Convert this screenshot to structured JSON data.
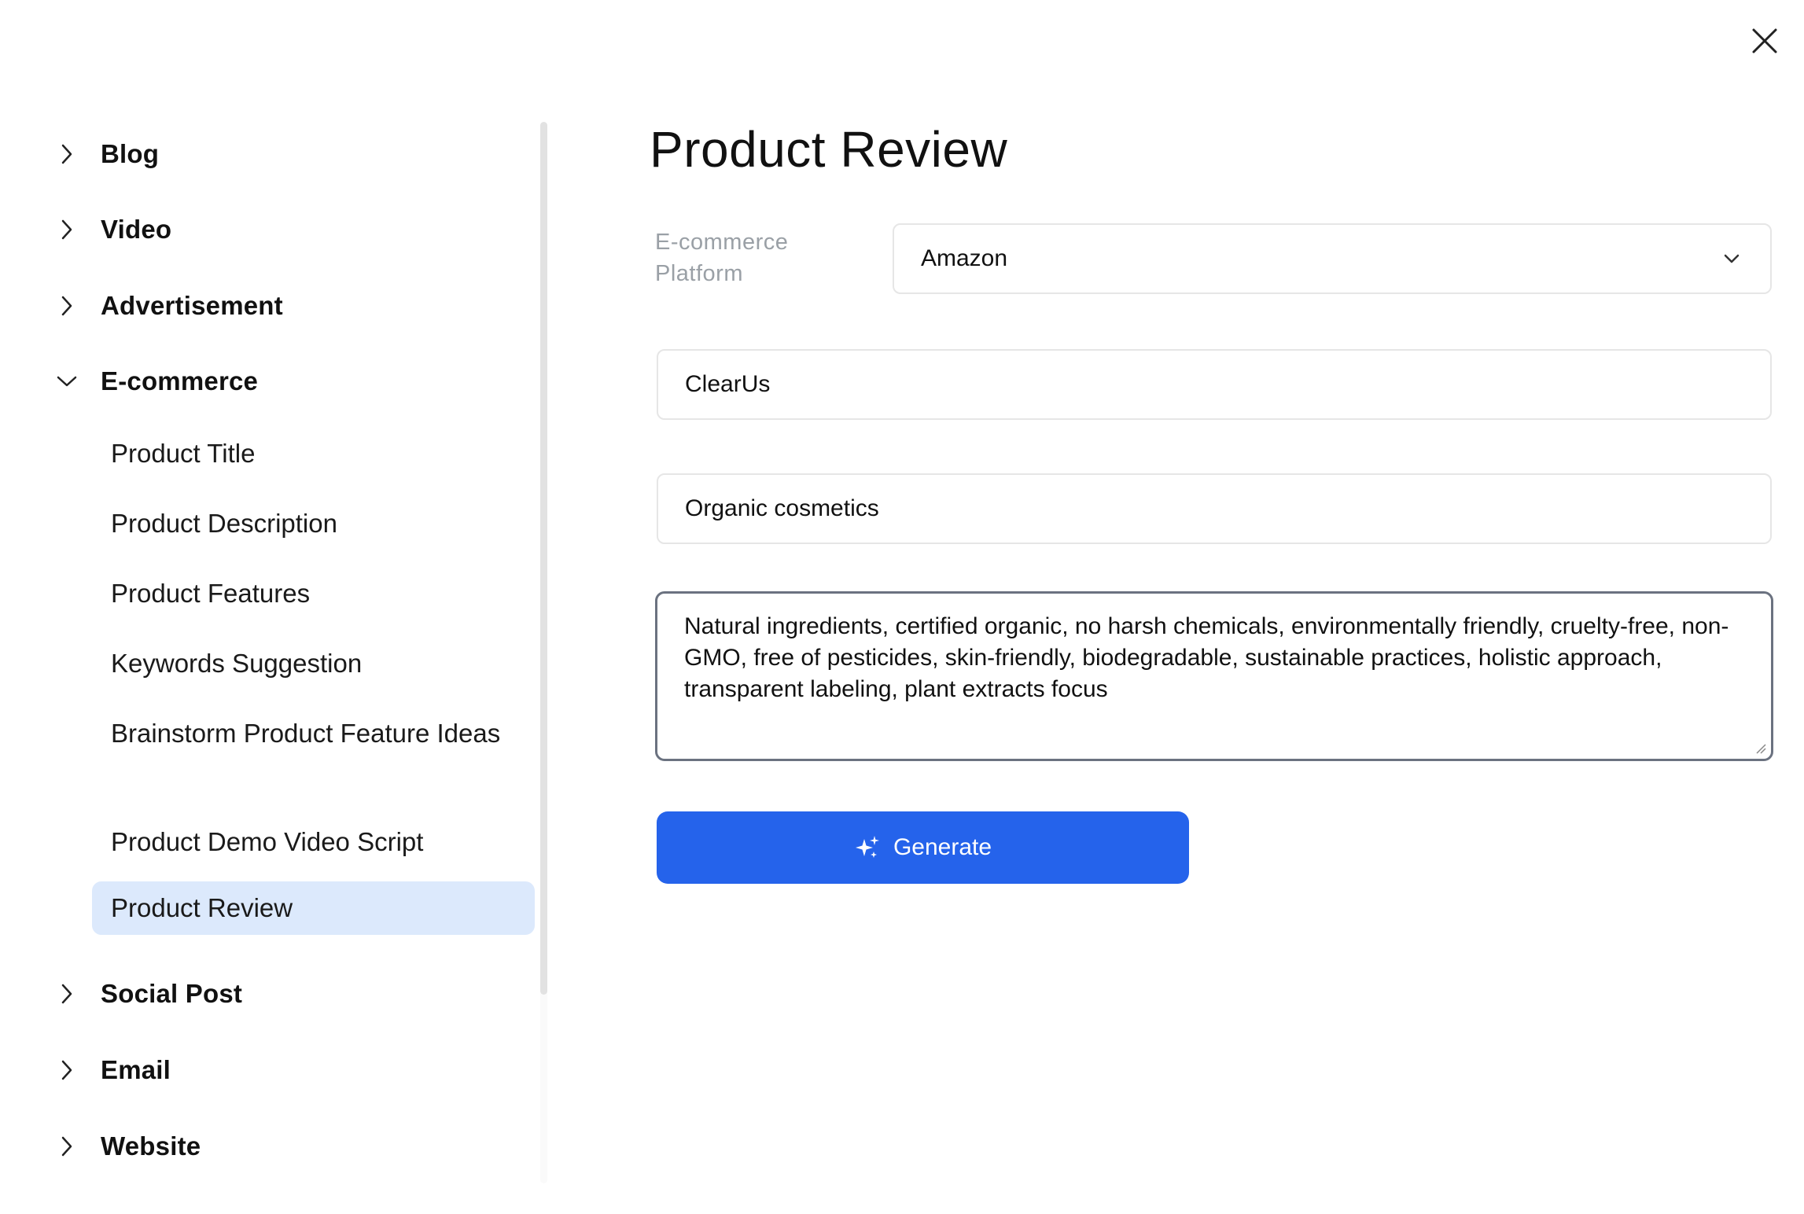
{
  "dialog": {
    "close_icon": "close-icon"
  },
  "sidebar": {
    "categories": [
      {
        "label": "Blog",
        "expanded": false
      },
      {
        "label": "Video",
        "expanded": false
      },
      {
        "label": "Advertisement",
        "expanded": false
      },
      {
        "label": "E-commerce",
        "expanded": true
      },
      {
        "label": "Social Post",
        "expanded": false
      },
      {
        "label": "Email",
        "expanded": false
      },
      {
        "label": "Website",
        "expanded": false
      }
    ],
    "ecommerce_items": [
      {
        "label": "Product Title",
        "active": false
      },
      {
        "label": "Product Description",
        "active": false
      },
      {
        "label": "Product Features",
        "active": false
      },
      {
        "label": "Keywords Suggestion",
        "active": false
      },
      {
        "label": "Brainstorm Product Feature Ideas",
        "active": false
      },
      {
        "label": "Product Demo Video Script",
        "active": false
      },
      {
        "label": "Product Review",
        "active": true
      }
    ]
  },
  "main": {
    "title": "Product Review",
    "platform": {
      "label": "E-commerce Platform",
      "value": "Amazon"
    },
    "product_name": {
      "value": "ClearUs"
    },
    "product_category": {
      "value": "Organic cosmetics"
    },
    "features": {
      "value": "Natural ingredients, certified organic, no harsh chemicals, environmentally friendly, cruelty-free, non-GMO, free of pesticides, skin-friendly, biodegradable, sustainable practices, holistic approach, transparent labeling, plant extracts focus"
    },
    "generate_button": {
      "label": "Generate",
      "icon": "sparkles-icon"
    }
  },
  "colors": {
    "accent": "#2563eb",
    "active_item_bg": "#dce9fc",
    "muted_label": "#9aa0a6"
  }
}
